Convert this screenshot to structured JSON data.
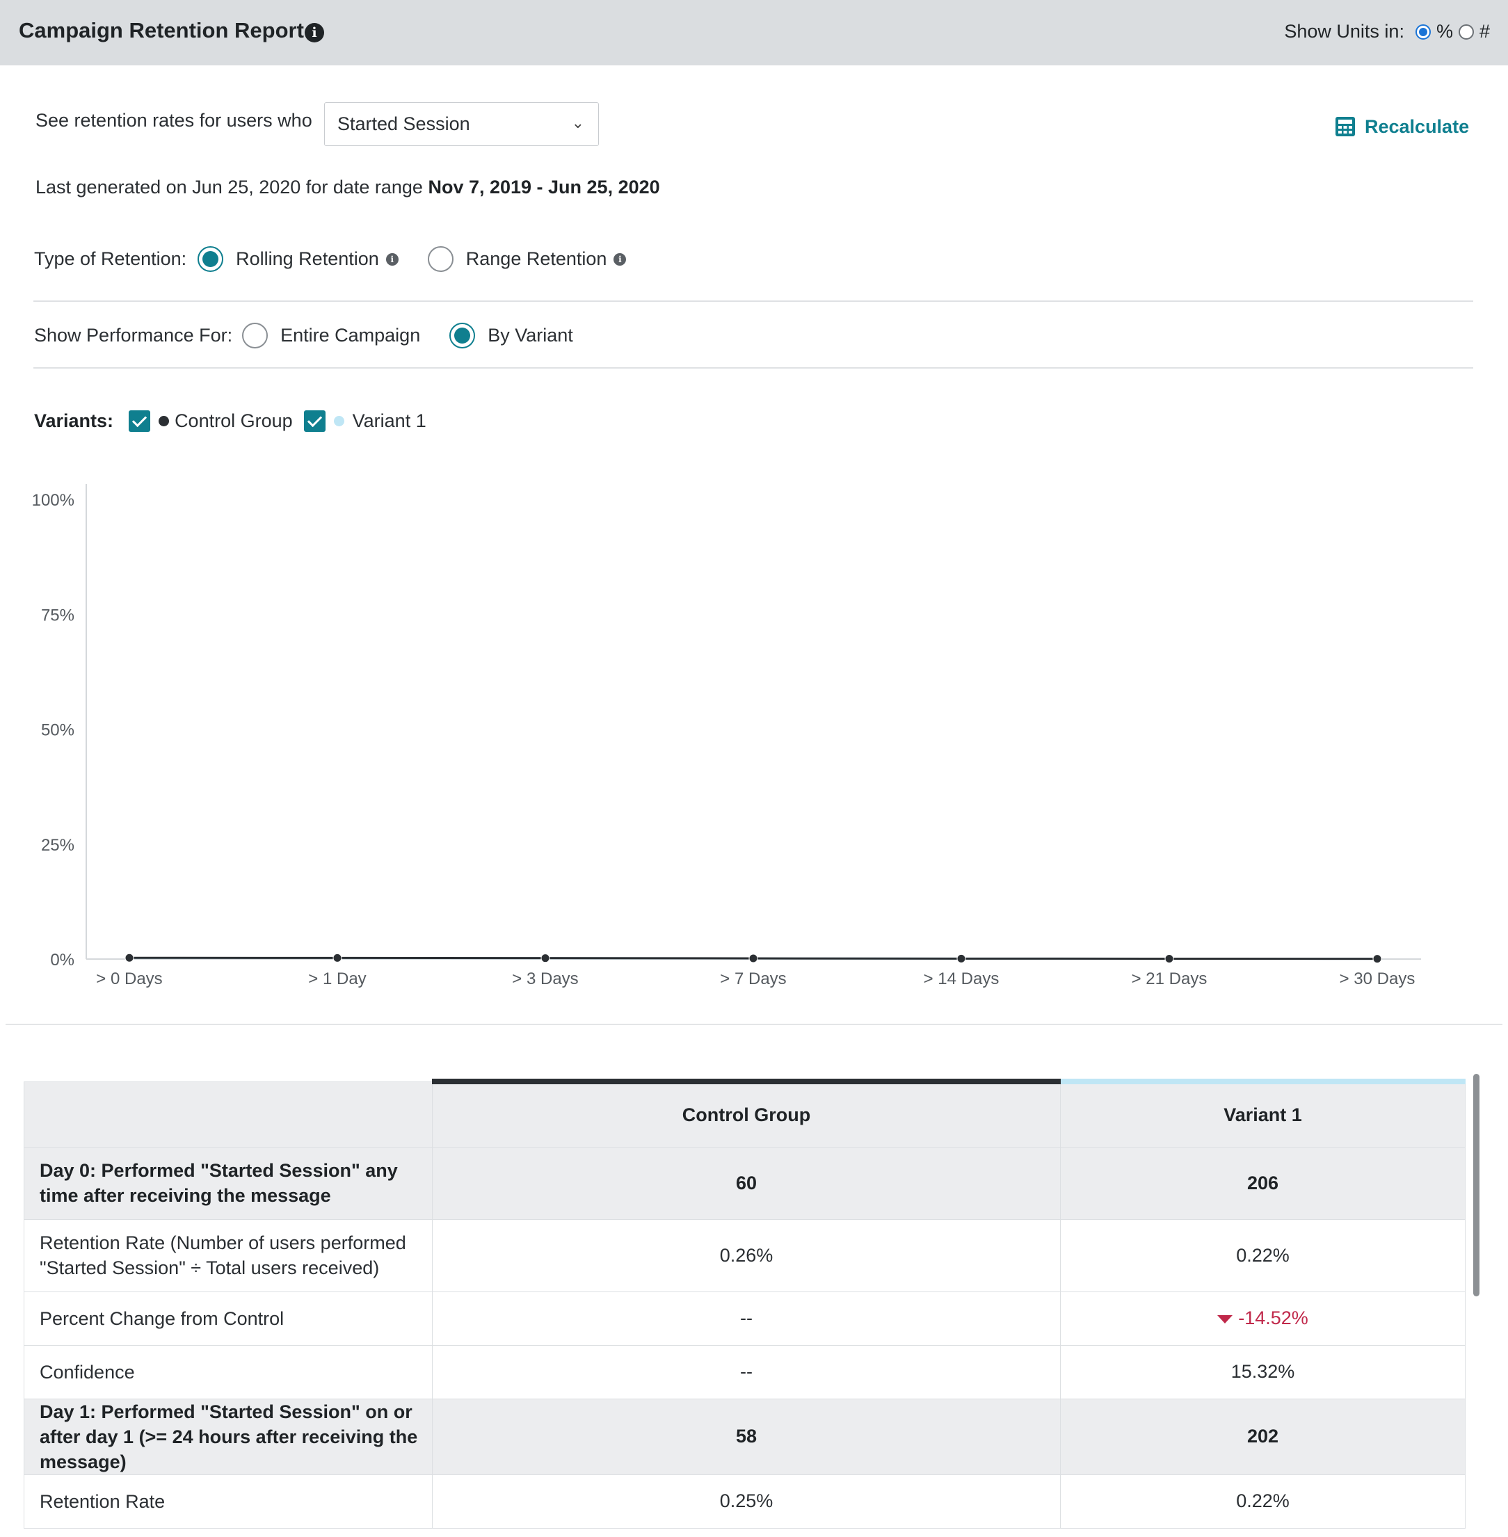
{
  "header": {
    "title": "Campaign Retention Report",
    "units_label": "Show Units in:",
    "unit_percent": "%",
    "unit_count": "#"
  },
  "filter": {
    "label": "See retention rates for users who",
    "selected": "Started Session",
    "recalculate": "Recalculate"
  },
  "generated": {
    "prefix": "Last generated on Jun 25, 2020 for date range",
    "range": "Nov 7, 2019 - Jun 25, 2020"
  },
  "retention_type": {
    "label": "Type of Retention:",
    "options": [
      "Rolling Retention",
      "Range Retention"
    ],
    "selected": "Rolling Retention"
  },
  "performance": {
    "label": "Show Performance For:",
    "options": [
      "Entire Campaign",
      "By Variant"
    ],
    "selected": "By Variant"
  },
  "variants": {
    "label": "Variants:",
    "items": [
      {
        "name": "Control Group",
        "color": "#2b2f33",
        "checked": true
      },
      {
        "name": "Variant 1",
        "color": "#bfe6f5",
        "checked": true
      }
    ]
  },
  "chart_data": {
    "type": "line",
    "categories": [
      "> 0 Days",
      "> 1 Day",
      "> 3 Days",
      "> 7 Days",
      "> 14 Days",
      "> 21 Days",
      "> 30 Days"
    ],
    "ylim": [
      0,
      100
    ],
    "yticks": [
      "0%",
      "25%",
      "50%",
      "75%",
      "100%"
    ],
    "series": [
      {
        "name": "Control Group",
        "color": "#2b2f33",
        "values": [
          0.26,
          0.25,
          0.2,
          0.15,
          0.1,
          0.08,
          0.06
        ]
      },
      {
        "name": "Variant 1",
        "color": "#bfe6f5",
        "values": [
          0.22,
          0.22,
          0.18,
          0.14,
          0.1,
          0.08,
          0.06
        ]
      }
    ]
  },
  "table": {
    "columns": [
      "",
      "Control Group",
      "Variant 1"
    ],
    "column_colors": [
      "",
      "#2b2f33",
      "#bfe6f5"
    ],
    "rows": [
      {
        "group": true,
        "label": "Day 0: Performed \"Started Session\" any time after receiving the message",
        "values": [
          "60",
          "206"
        ]
      },
      {
        "group": false,
        "label": "Retention Rate (Number of users performed \"Started Session\" ÷ Total users received)",
        "values": [
          "0.26%",
          "0.22%"
        ]
      },
      {
        "group": false,
        "label": "Percent Change from Control",
        "values": [
          "--",
          "-14.52%"
        ],
        "negative_index": 1
      },
      {
        "group": false,
        "label": "Confidence",
        "values": [
          "--",
          "15.32%"
        ]
      },
      {
        "group": true,
        "label": "Day 1: Performed \"Started Session\" on or after day 1 (>= 24 hours after receiving the message)",
        "values": [
          "58",
          "202"
        ]
      },
      {
        "group": false,
        "label": "Retention Rate",
        "values": [
          "0.25%",
          "0.22%"
        ]
      }
    ]
  }
}
